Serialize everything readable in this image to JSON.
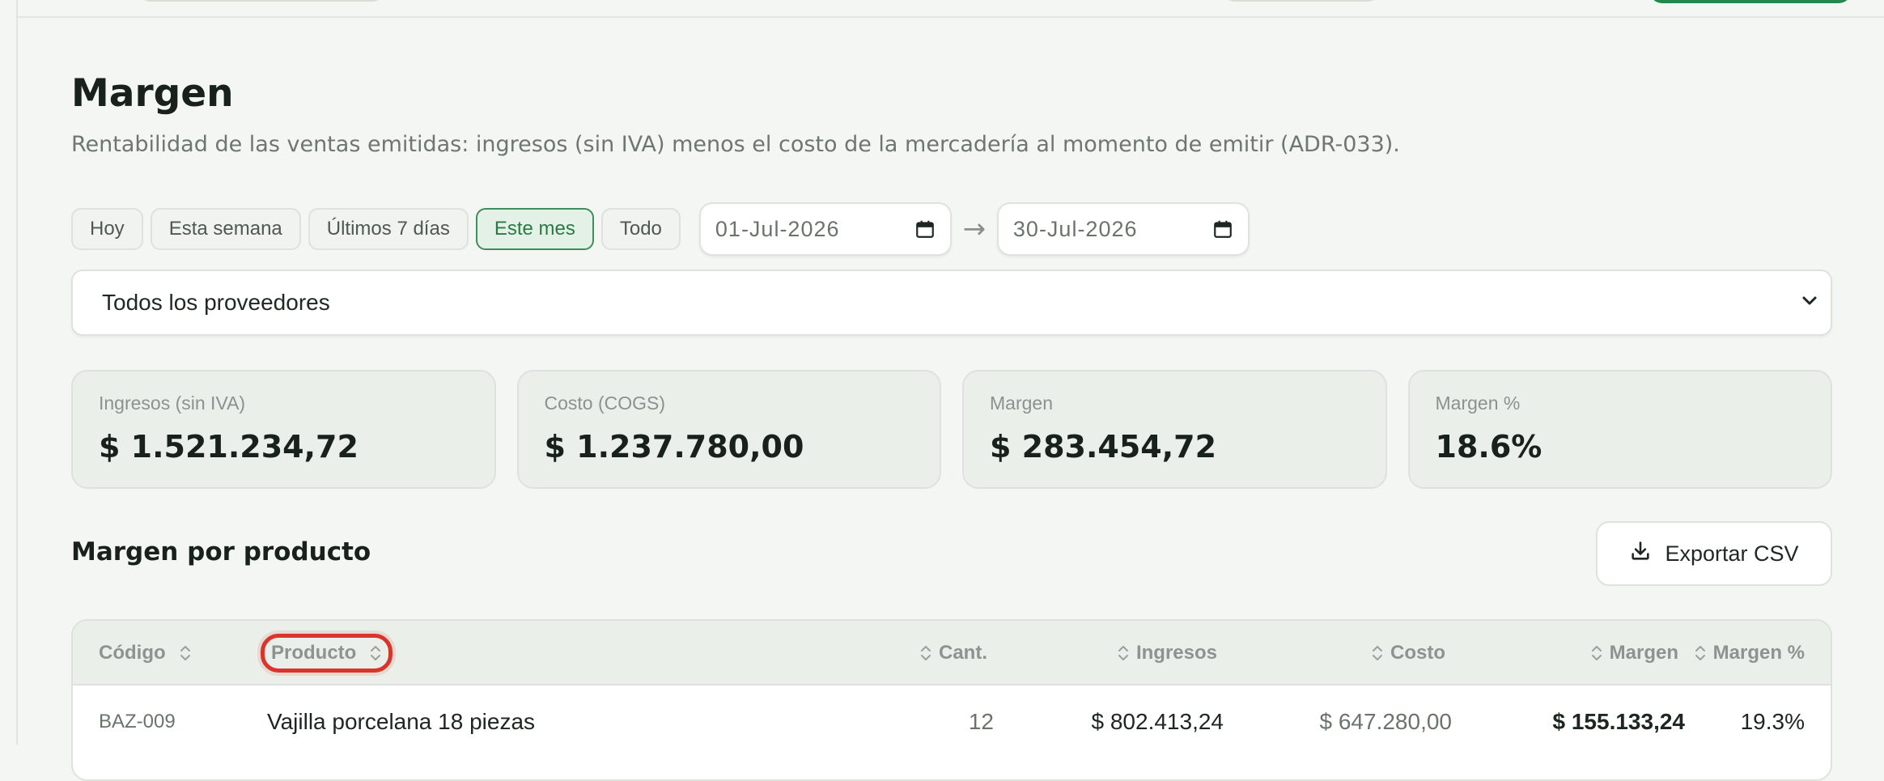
{
  "page": {
    "title": "Margen",
    "subtitle": "Rentabilidad de las ventas emitidas: ingresos (sin IVA) menos el costo de la mercadería al momento de emitir (ADR-033)."
  },
  "filters": {
    "presets": [
      {
        "label": "Hoy",
        "active": false
      },
      {
        "label": "Esta semana",
        "active": false
      },
      {
        "label": "Últimos 7 días",
        "active": false
      },
      {
        "label": "Este mes",
        "active": true
      },
      {
        "label": "Todo",
        "active": false
      }
    ],
    "date_from": "01-Jul-2026",
    "date_separator": "→",
    "date_to": "30-Jul-2026"
  },
  "supplier": {
    "selected": "Todos los proveedores"
  },
  "stats": [
    {
      "label": "Ingresos (sin IVA)",
      "value": "$ 1.521.234,72"
    },
    {
      "label": "Costo (COGS)",
      "value": "$ 1.237.780,00"
    },
    {
      "label": "Margen",
      "value": "$ 283.454,72"
    },
    {
      "label": "Margen %",
      "value": "18.6%"
    }
  ],
  "section": {
    "title": "Margen por producto",
    "export_label": "Exportar CSV"
  },
  "table": {
    "columns": [
      "Código",
      "Producto",
      "Cant.",
      "Ingresos",
      "Costo",
      "Margen",
      "Margen %"
    ],
    "rows": [
      {
        "codigo": "BAZ-009",
        "producto": "Vajilla porcelana 18 piezas",
        "cantidad": "12",
        "ingresos": "$ 802.413,24",
        "costo": "$ 647.280,00",
        "margen": "$ 155.133,24",
        "margen_pct": "19.3%"
      }
    ]
  },
  "colors": {
    "accent": "#2a7a46",
    "highlight_ring": "#d9352b"
  }
}
